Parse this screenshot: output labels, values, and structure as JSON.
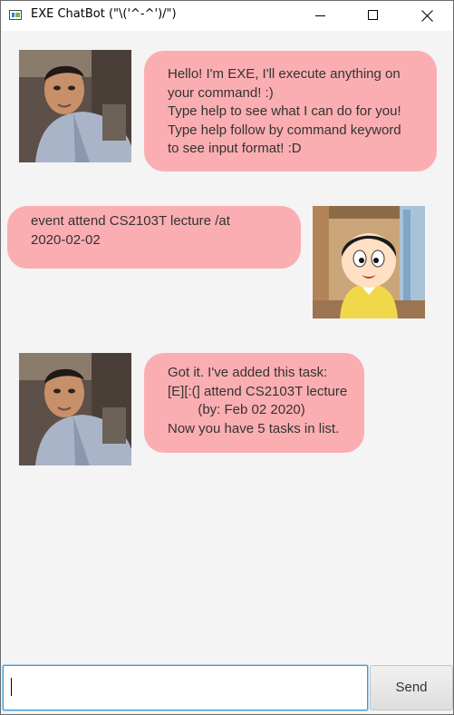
{
  "window": {
    "title": "EXE ChatBot (\"\\('^-^')/\")"
  },
  "messages": [
    {
      "sender": "bot",
      "text": "Hello! I'm EXE, I'll execute anything on\nyour command! :)\nType help to see what I can do for you!\nType help follow by command keyword\nto see input format! :D"
    },
    {
      "sender": "user",
      "text": "event attend CS2103T lecture /at\n2020-02-02"
    },
    {
      "sender": "bot",
      "text": "Got it. I've added this task:\n[E][:(] attend CS2103T lecture\n        (by: Feb 02 2020)\nNow you have 5 tasks in list."
    }
  ],
  "input": {
    "value": "",
    "placeholder": ""
  },
  "send_label": "Send",
  "colors": {
    "bubble": "#fbaeb1",
    "background": "#f4f4f4",
    "input_focus": "#3d9ad8"
  }
}
